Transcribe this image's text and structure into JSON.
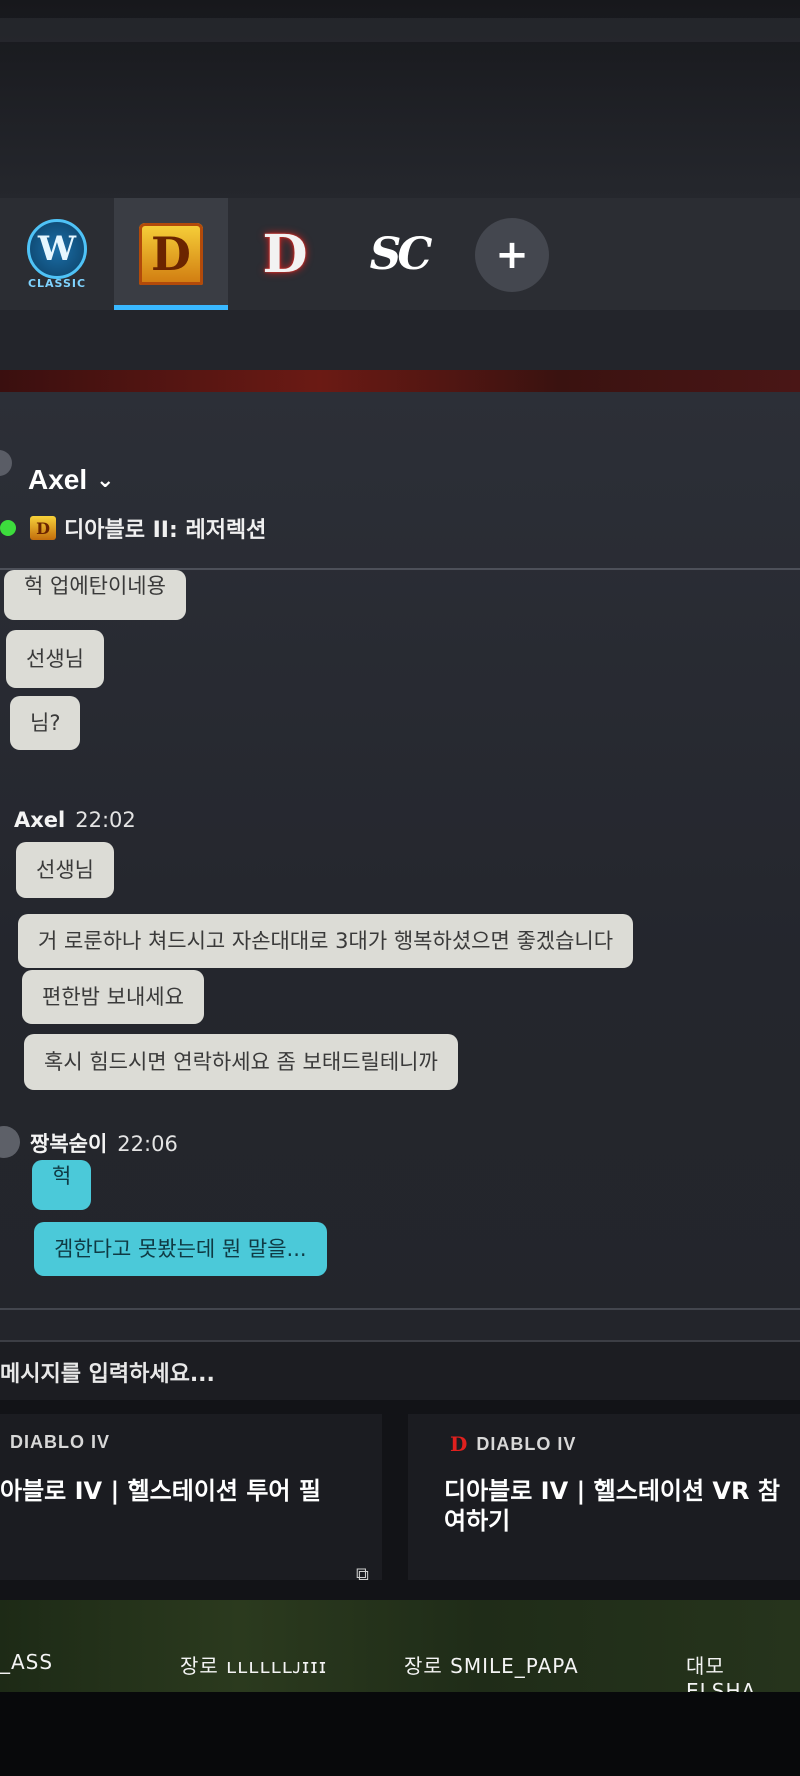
{
  "tabs": [
    {
      "id": "wow-classic",
      "glyph": "W",
      "caption": "CLASSIC",
      "active": false
    },
    {
      "id": "diablo2",
      "glyph": "D",
      "active": true
    },
    {
      "id": "diablo4",
      "glyph": "D",
      "active": false
    },
    {
      "id": "starcraft",
      "glyph": "SC",
      "active": false
    }
  ],
  "add_tab_label": "+",
  "chat": {
    "contact_name": "Axel",
    "chevron": "⌄",
    "status_game_glyph": "D",
    "status_game": "디아블로 II: 레저렉션",
    "group1": [
      "헉 업에탄이네용",
      "선생님",
      "님?"
    ],
    "group2": {
      "sender": "Axel",
      "time": "22:02",
      "messages": [
        "선생님",
        "거 로룬하나 쳐드시고 자손대대로 3대가 행복하셨으면 좋겠습니다",
        "편한밤 보내세요",
        "혹시 힘드시면 연락하세요 좀 보태드릴테니까"
      ]
    },
    "group3": {
      "sender": "짱복숟이",
      "time": "22:06",
      "messages": [
        "헉",
        "겜한다고 못봤는데 뭔 말을..."
      ]
    }
  },
  "input": {
    "placeholder": "메시지를 입력하세요..."
  },
  "news": [
    {
      "tag": "DIABLO IV",
      "title": "아블로 IV | 헬스테이션 투어 필",
      "ext_icon": "⧉"
    },
    {
      "tag": "DIABLO IV",
      "tag_glyph": "D",
      "title_line1": "디아블로 IV | 헬스테이션 VR 참",
      "title_line2": "여하기"
    }
  ],
  "banner": {
    "item1": "_ASS",
    "item2": "장로 ʟʟʟʟʟʟᴊɪɪɪ",
    "item3": "장로 SMILE_PAPA",
    "item4": "대모 ELSHA"
  }
}
